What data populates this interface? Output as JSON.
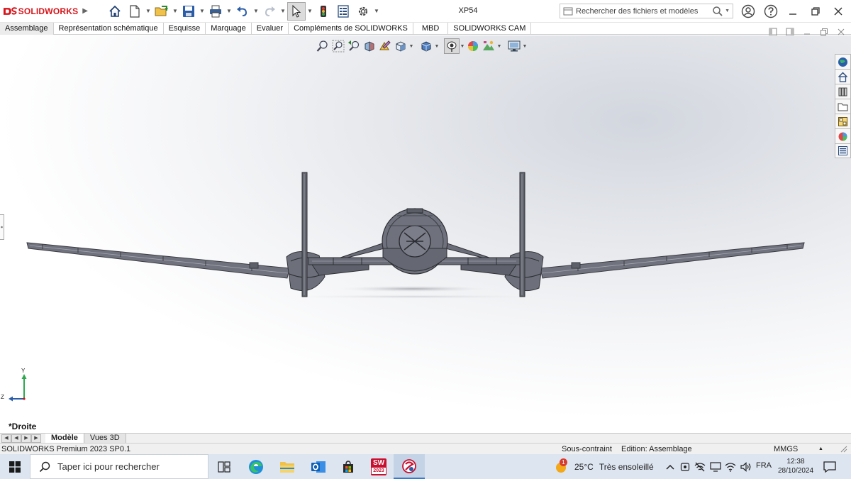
{
  "app": {
    "logo_brand": "SOLIDWORKS",
    "document_title": "XP54"
  },
  "search": {
    "placeholder": "Rechercher des fichiers et modèles"
  },
  "tabs": [
    {
      "label": "Assemblage",
      "active": true
    },
    {
      "label": "Représentation schématique"
    },
    {
      "label": "Esquisse"
    },
    {
      "label": "Marquage"
    },
    {
      "label": "Evaluer"
    },
    {
      "label": "Compléments de SOLIDWORKS"
    },
    {
      "label": "MBD"
    },
    {
      "label": "SOLIDWORKS CAM"
    }
  ],
  "viewport": {
    "view_name": "*Droite",
    "axis_y": "Y",
    "axis_z": "Z"
  },
  "bottom_tabs": [
    {
      "label": "Modèle",
      "active": true
    },
    {
      "label": "Vues 3D"
    }
  ],
  "status": {
    "product": "SOLIDWORKS Premium 2023 SP0.1",
    "constraint": "Sous-contraint",
    "edition": "Edition: Assemblage",
    "units": "MMGS"
  },
  "taskbar": {
    "search_placeholder": "Taper ici pour rechercher",
    "sw_badge_top": "SW",
    "sw_badge_year": "2023",
    "weather_badge": "1",
    "temperature": "25°C",
    "weather": "Très ensoleillé",
    "language": "FRA",
    "time": "12:38",
    "date": "28/10/2024"
  },
  "colors": {
    "brand_red": "#d7141a",
    "taskbar_bg": "#dde5f0",
    "model_gray": "#6b6c77"
  }
}
